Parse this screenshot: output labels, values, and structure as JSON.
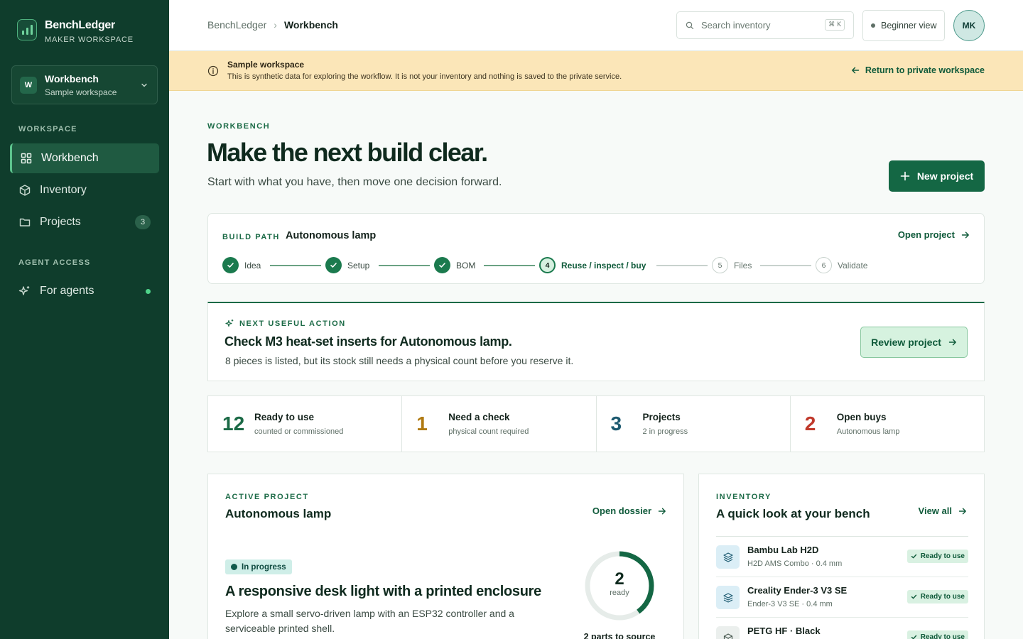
{
  "sidebar": {
    "brand_name": "BenchLedger",
    "brand_sub": "MAKER WORKSPACE",
    "workspace": {
      "avatar": "W",
      "name": "Workbench",
      "sub": "Sample workspace"
    },
    "section_workspace": "WORKSPACE",
    "section_agent": "AGENT ACCESS",
    "items": [
      {
        "label": "Workbench",
        "icon": "grid-icon",
        "active": true
      },
      {
        "label": "Inventory",
        "icon": "box-icon"
      },
      {
        "label": "Projects",
        "icon": "folder-icon",
        "badge": "3"
      },
      {
        "label": "For agents",
        "icon": "sparkle-icon",
        "status": "online"
      }
    ]
  },
  "header": {
    "breadcrumb": [
      "BenchLedger",
      "Workbench"
    ],
    "search_placeholder": "Search inventory",
    "shortcut": "⌘ K",
    "mode_label": "Beginner view",
    "avatar_initials": "MK"
  },
  "banner": {
    "title": "Sample workspace",
    "text": "This is synthetic data for exploring the workflow. It is not your inventory and nothing is saved to the private service.",
    "link": "Return to private workspace"
  },
  "hero": {
    "eyebrow": "WORKBENCH",
    "title": "Make the next build clear.",
    "subtitle": "Start with what you have, then move one decision forward.",
    "cta": "New project"
  },
  "build_path": {
    "eyebrow": "BUILD PATH",
    "project": "Autonomous lamp",
    "link": "Open project",
    "steps": [
      {
        "num": "1",
        "label": "Idea",
        "state": "done"
      },
      {
        "num": "2",
        "label": "Setup",
        "state": "done"
      },
      {
        "num": "3",
        "label": "BOM",
        "state": "done"
      },
      {
        "num": "4",
        "label": "Reuse / inspect / buy",
        "state": "current"
      },
      {
        "num": "5",
        "label": "Files",
        "state": "todo"
      },
      {
        "num": "6",
        "label": "Validate",
        "state": "todo"
      }
    ]
  },
  "next_action": {
    "eyebrow": "NEXT USEFUL ACTION",
    "title": "Check M3 heat-set inserts for Autonomous lamp.",
    "text": "8 pieces is listed, but its stock still needs a physical count before you reserve it.",
    "button": "Review project"
  },
  "stats": [
    {
      "value": "12",
      "label": "Ready to use",
      "sub": "counted or commissioned",
      "color": "#1b6a46"
    },
    {
      "value": "1",
      "label": "Need a check",
      "sub": "physical count required",
      "color": "#b07a12"
    },
    {
      "value": "3",
      "label": "Projects",
      "sub": "2 in progress",
      "color": "#1d5a70"
    },
    {
      "value": "2",
      "label": "Open buys",
      "sub": "Autonomous lamp",
      "color": "#c0392b"
    }
  ],
  "active_project": {
    "eyebrow": "ACTIVE PROJECT",
    "title": "Autonomous lamp",
    "link": "Open dossier",
    "status": "In progress",
    "headline": "A responsive desk light with a printed enclosure",
    "description": "Explore a small servo-driven lamp with an ESP32 controller and a serviceable printed shell.",
    "ready_count": "2",
    "ready_label": "ready",
    "ready_fraction": 0.4,
    "caption": "2 parts to source"
  },
  "inventory": {
    "eyebrow": "INVENTORY",
    "title": "A quick look at your bench",
    "link": "View all",
    "items": [
      {
        "name": "Bambu Lab H2D",
        "sub": "H2D AMS Combo · 0.4 mm",
        "status": "Ready to use",
        "icon": "layers-icon"
      },
      {
        "name": "Creality Ender-3 V3 SE",
        "sub": "Ender-3 V3 SE · 0.4 mm",
        "status": "Ready to use",
        "icon": "layers-icon"
      },
      {
        "name": "PETG HF · Black",
        "sub": "",
        "status": "Ready to use",
        "icon": "box-icon"
      }
    ]
  },
  "colors": {
    "sidebar_bg": "#0f3d2c",
    "accent": "#146744",
    "banner_bg": "#fbe6b8"
  }
}
